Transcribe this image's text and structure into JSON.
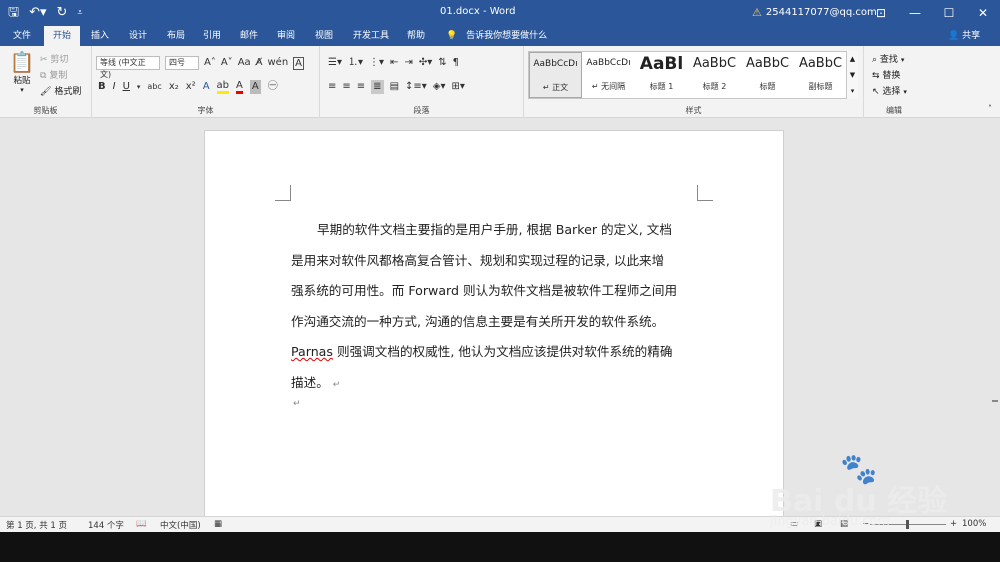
{
  "titlebar": {
    "document_title": "01.docx - Word",
    "account": "2544117077@qq.com",
    "qat_icons": [
      "save-icon",
      "undo-icon",
      "redo-icon",
      "customize-icon"
    ]
  },
  "tabs": [
    {
      "label": "文件",
      "active": false
    },
    {
      "label": "开始",
      "active": true
    },
    {
      "label": "插入",
      "active": false
    },
    {
      "label": "设计",
      "active": false
    },
    {
      "label": "布局",
      "active": false
    },
    {
      "label": "引用",
      "active": false
    },
    {
      "label": "邮件",
      "active": false
    },
    {
      "label": "审阅",
      "active": false
    },
    {
      "label": "视图",
      "active": false
    },
    {
      "label": "开发工具",
      "active": false
    },
    {
      "label": "帮助",
      "active": false
    }
  ],
  "tell_me": "告诉我你想要做什么",
  "share": "共享",
  "clipboard": {
    "paste": "粘贴",
    "cut": "剪切",
    "copy": "复制",
    "format_painter": "格式刷",
    "group_label": "剪贴板"
  },
  "font": {
    "font_name": "等线 (中文正文)",
    "font_size": "四号",
    "group_label": "字体"
  },
  "paragraph": {
    "group_label": "段落"
  },
  "styles": {
    "group_label": "样式",
    "items": [
      {
        "preview": "AaBbCcDı",
        "name": "↵ 正文",
        "selected": true
      },
      {
        "preview": "AaBbCcDı",
        "name": "↵ 无间隔",
        "selected": false
      },
      {
        "preview": "AaBl",
        "name": "标题 1",
        "selected": false
      },
      {
        "preview": "AaBbC",
        "name": "标题 2",
        "selected": false
      },
      {
        "preview": "AaBbC",
        "name": "标题",
        "selected": false
      },
      {
        "preview": "AaBbC",
        "name": "副标题",
        "selected": false
      }
    ]
  },
  "editing": {
    "find": "查找",
    "replace": "替换",
    "select": "选择",
    "group_label": "编辑"
  },
  "document": {
    "lines": [
      "早期的软件文档主要指的是用户手册, 根据 Barker 的定义, 文档",
      "是用来对软件风都格高复合管计、规划和实现过程的记录, 以此来增",
      "强系统的可用性。而 Forward 则认为软件文档是被软件工程师之间用",
      "作沟通交流的一种方式, 沟通的信息主要是有关所开发的软件系统。",
      " 则强调文档的权威性, 他认为文档应该提供对软件系统的精确",
      "描述。"
    ],
    "misspelled_word": "Parnas",
    "para_mark": "↵"
  },
  "status": {
    "page": "第 1 页, 共 1 页",
    "words": "144 个字",
    "language": "中文(中国)",
    "zoom": "100%"
  },
  "watermark": {
    "brand": "Bai du 经验",
    "url": "jingyan.baidu.com"
  }
}
